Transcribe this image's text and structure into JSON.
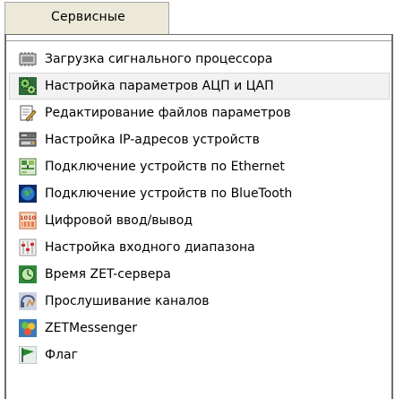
{
  "menu": {
    "title": "Сервисные",
    "items": [
      {
        "label": "Загрузка сигнального процессора",
        "icon": "chip-icon"
      },
      {
        "label": "Настройка параметров АЦП и ЦАП",
        "icon": "gears-icon"
      },
      {
        "label": "Редактирование файлов параметров",
        "icon": "edit-file-icon"
      },
      {
        "label": "Настройка IP-адресов устройств",
        "icon": "network-devices-icon"
      },
      {
        "label": "Подключение устройств по Ethernet",
        "icon": "ethernet-icon"
      },
      {
        "label": "Подключение устройств по BlueTooth",
        "icon": "bluetooth-globe-icon"
      },
      {
        "label": "Цифровой ввод/вывод",
        "icon": "digital-io-icon"
      },
      {
        "label": "Настройка входного диапазона",
        "icon": "range-sliders-icon"
      },
      {
        "label": "Время ZET-сервера",
        "icon": "server-clock-icon"
      },
      {
        "label": "Прослушивание каналов",
        "icon": "listen-channels-icon"
      },
      {
        "label": "ZETMessenger",
        "icon": "messenger-icon"
      },
      {
        "label": "Флаг",
        "icon": "flag-icon"
      }
    ]
  },
  "colors": {
    "tab_bg": "#ece9d8",
    "hover_bg": "#f2f2f2",
    "border": "#6d6d6d"
  }
}
